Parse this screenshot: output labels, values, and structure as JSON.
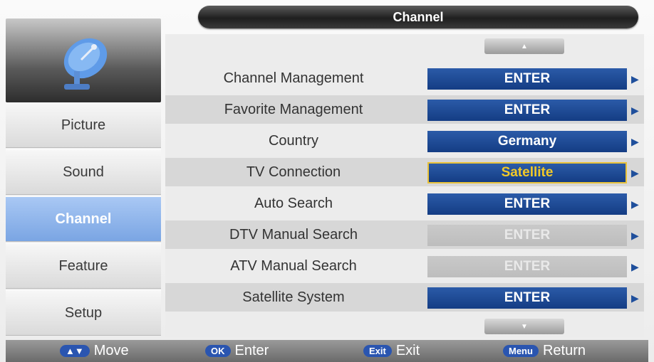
{
  "title": "Channel",
  "sidebar": {
    "items": [
      {
        "label": "Picture"
      },
      {
        "label": "Sound"
      },
      {
        "label": "Channel"
      },
      {
        "label": "Feature"
      },
      {
        "label": "Setup"
      }
    ],
    "active_icon": "satellite-dish-icon"
  },
  "menu": {
    "rows": [
      {
        "label": "Channel Management",
        "value": "ENTER"
      },
      {
        "label": "Favorite Management",
        "value": "ENTER"
      },
      {
        "label": "Country",
        "value": "Germany"
      },
      {
        "label": "TV Connection",
        "value": "Satellite"
      },
      {
        "label": "Auto Search",
        "value": "ENTER"
      },
      {
        "label": "DTV Manual Search",
        "value": "ENTER"
      },
      {
        "label": "ATV Manual Search",
        "value": "ENTER"
      },
      {
        "label": "Satellite System",
        "value": "ENTER"
      }
    ]
  },
  "hints": [
    {
      "key": "▲▼",
      "label": "Move"
    },
    {
      "key": "OK",
      "label": "Enter"
    },
    {
      "key": "Exit",
      "label": "Exit"
    },
    {
      "key": "Menu",
      "label": "Return"
    }
  ],
  "colors": {
    "accent": "#143d84",
    "selected": "#e8c23a",
    "active_sidebar": "#7aa5e3"
  }
}
